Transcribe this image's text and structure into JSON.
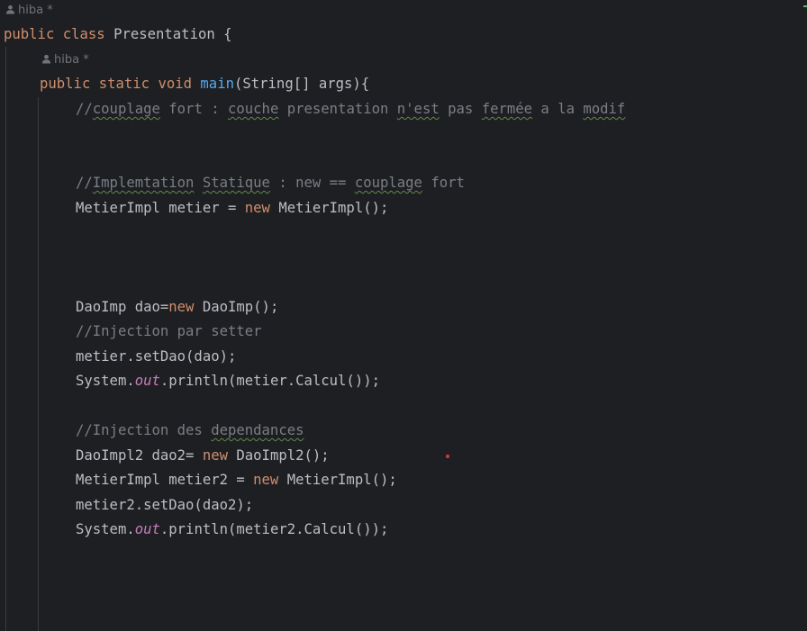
{
  "editor": {
    "class_author": {
      "name": "hiba",
      "modified": "*"
    },
    "method_author": {
      "name": "hiba",
      "modified": "*"
    },
    "line_class": {
      "kw_public": "public",
      "kw_class": "class",
      "class_name": "Presentation {"
    },
    "line_method": {
      "kw_public": "public",
      "kw_static": "static",
      "kw_void": "void",
      "method_name": "main",
      "signature": "(String[] args){"
    },
    "comment1": {
      "prefix": "//",
      "w1": "couplage",
      "t1": " fort : ",
      "w2": "couche",
      "t2": " presentation ",
      "w3": "n'est",
      "t3": " pas ",
      "w4": "fermée",
      "t4": " a la ",
      "w5": "modif"
    },
    "comment2": {
      "prefix": "//",
      "w1": "Implemtation",
      "t1": " ",
      "w2": "Statique",
      "t2": " : new == ",
      "w3": "couplage",
      "t3": " fort"
    },
    "line_metier": {
      "decl": "MetierImpl metier = ",
      "kw_new": "new",
      "rest": " MetierImpl();"
    },
    "line_dao": {
      "decl": "DaoImp dao=",
      "kw_new": "new",
      "rest": " DaoImp();"
    },
    "comment3": "//Injection par setter",
    "line_setdao": "metier.setDao(dao);",
    "line_println1": {
      "pre": "System.",
      "field": "out",
      "post": ".println(metier.Calcul());"
    },
    "comment4": {
      "prefix": "//Injection des ",
      "w1": "dependances"
    },
    "line_dao2": {
      "decl": "DaoImpl2 dao2= ",
      "kw_new": "new",
      "rest": " DaoImpl2();"
    },
    "line_metier2": {
      "decl": "MetierImpl metier2 = ",
      "kw_new": "new",
      "rest": " MetierImpl();"
    },
    "line_setdao2": "metier2.setDao(dao2);",
    "line_println2": {
      "pre": "System.",
      "field": "out",
      "post": ".println(metier2.Calcul());"
    }
  },
  "colors": {
    "background": "#1e1f22",
    "text": "#bcbec4",
    "keyword": "#cf8e6d",
    "method": "#56a8f5",
    "static_field": "#c77dbb",
    "comment": "#7a7e85",
    "author_hint": "#6f737a",
    "typo_underline": "#5f8c4a",
    "error_dot": "#d33b3b"
  }
}
